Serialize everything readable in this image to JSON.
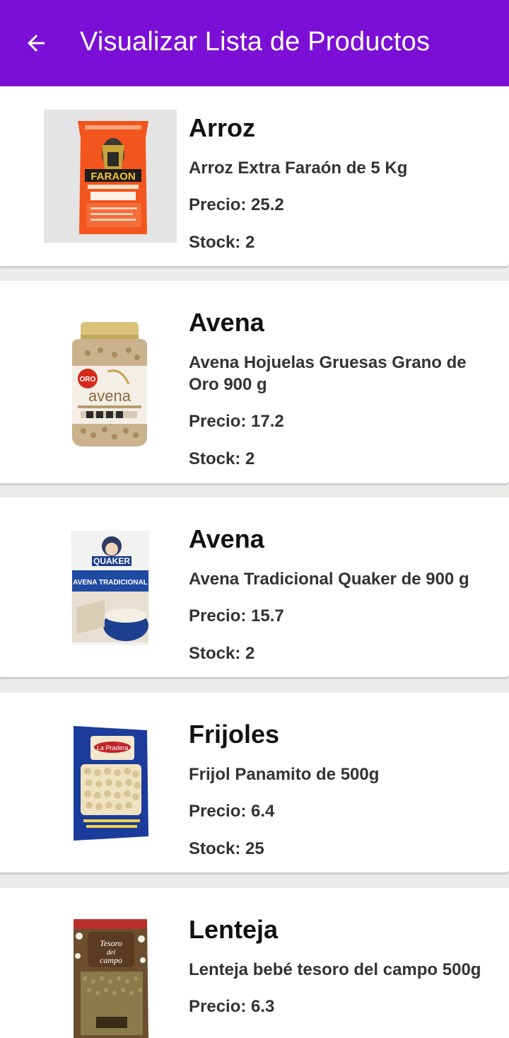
{
  "app_bar": {
    "title": "Visualizar Lista de Productos",
    "back_icon": "arrow-left-icon",
    "background": "#7c0fd6"
  },
  "products": [
    {
      "name": "Arroz",
      "description": "Arroz Extra Faraón de 5 Kg",
      "price_text": "Precio: 25.2",
      "stock_text": "Stock: 2",
      "image_label": "FARAON"
    },
    {
      "name": "Avena",
      "description": "Avena Hojuelas Gruesas Grano de Oro 900 g",
      "price_text": "Precio: 17.2",
      "stock_text": "Stock: 2",
      "image_label": "avena"
    },
    {
      "name": "Avena",
      "description": "Avena Tradicional Quaker de 900 g",
      "price_text": "Precio: 15.7",
      "stock_text": "Stock: 2",
      "image_label": "QUAKER"
    },
    {
      "name": "Frijoles",
      "description": "Frijol Panamito de 500g",
      "price_text": "Precio: 6.4",
      "stock_text": "Stock: 25",
      "image_label": "La Pradera"
    },
    {
      "name": "Lenteja",
      "description": "Lenteja bebé tesoro del campo 500g",
      "price_text": "Precio: 6.3",
      "stock_text": "",
      "image_label": "Tesoro del campo"
    }
  ]
}
